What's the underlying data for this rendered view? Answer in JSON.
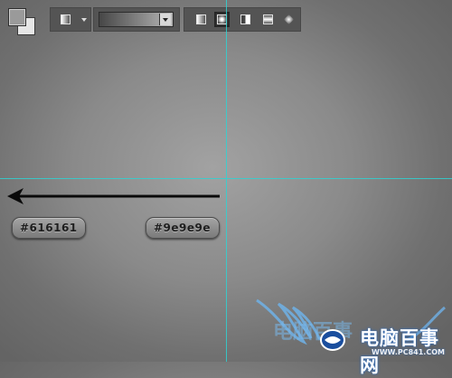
{
  "toolbar": {
    "foreground_color": "#9a9a9a",
    "background_color": "#e6e6e6",
    "tool_preset_icon": "gradient-tool-icon",
    "gradient_editor_from": "#474747",
    "gradient_editor_to": "#b7b7b7",
    "modes": [
      {
        "icon": "linear-gradient-icon",
        "active": false
      },
      {
        "icon": "radial-gradient-icon",
        "active": true
      },
      {
        "icon": "angle-gradient-icon",
        "active": false
      },
      {
        "icon": "reflected-gradient-icon",
        "active": false
      },
      {
        "icon": "diamond-gradient-icon",
        "active": false
      }
    ]
  },
  "canvas": {
    "center_color": "#9e9e9e",
    "edge_color": "#616161",
    "guide_color": "#2fd2d2",
    "arrow_icon": "left-arrow-icon"
  },
  "labels": {
    "edge_color_label": "#616161",
    "center_color_label": "#9e9e9e"
  },
  "watermark": {
    "title": "电脑百事网",
    "url": "WWW.PC841.COM"
  }
}
